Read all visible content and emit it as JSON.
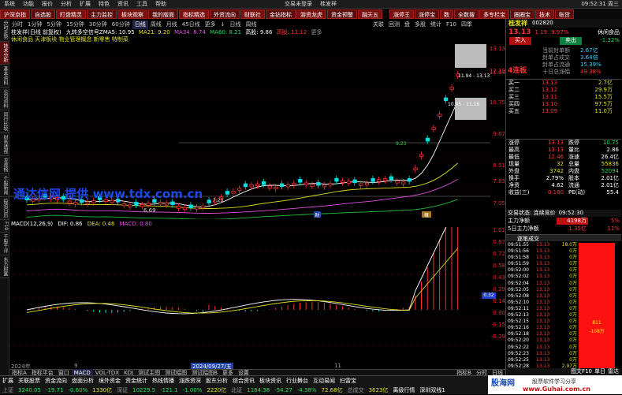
{
  "menu": {
    "items": [
      "系统",
      "功能",
      "报价",
      "分析",
      "扩展",
      "特色",
      "资讯",
      "工具",
      "帮助"
    ],
    "status": "交易未登录",
    "brand": "桂发祥",
    "clock": "09:52:31 周三"
  },
  "topbar": [
    "沪深京指",
    "自选股",
    "盯盘精灵",
    "主力监控",
    "板块观察",
    "我的版面",
    "指标精选",
    "外资流向",
    "财联社",
    "金钻指标",
    "游资龙虎",
    "资金预警",
    "融天五",
    "",
    "涨停王",
    "涨停宝",
    "数",
    "全数搜",
    "多专栏宝",
    "圈圈宝",
    "技术",
    "账贷"
  ],
  "left_strip": [
    "分时走势",
    "技术分析",
    "基本资料",
    "公司资料",
    "同行比较",
    "财务透视",
    "龙虎榜",
    "个股新闻",
    "投资日历",
    "F10",
    "千股千评",
    "东方财富"
  ],
  "period": [
    "分时",
    "1分钟",
    "5分钟",
    "15分钟",
    "30分钟",
    "60分钟",
    "日线",
    "周线",
    "月线",
    "45日线",
    "更多",
    "↓",
    "日线",
    "周线"
  ],
  "period_right": [
    "关联",
    "回测",
    "盘",
    "多股",
    "统计",
    "F10",
    "四季"
  ],
  "chart": {
    "title_line": "桂发祥(日线 前复权)",
    "ma_line": [
      "九转多空信号ZMA5: 10.95",
      "MA21: 9.20",
      "MA34: 8.74",
      "MA60: 8.21",
      "高股: 9.86",
      "高股: 11.12",
      "更多"
    ],
    "concept_line": "休闲食品 天津板块 物业管理概念 新零售 特制菜",
    "watermark": "通达信网 提供 www.tdx.com.cn",
    "price_label_low": "6.69",
    "price_label_mid1": "7.23",
    "price_label_mid2": "9.23",
    "price_label_box": "10.95 - 11.16",
    "price_label_top": "11.94 - 13.13",
    "ticks": [
      "13.13",
      "12.19",
      "11.04",
      "10.75",
      "9.67",
      "8.51",
      "7.83",
      "7.05"
    ],
    "macd_title": "MACD(12,26,9)",
    "macd_vals": [
      "DIF: 0.86",
      "DEA: 0.46",
      "MACD: 0.80"
    ],
    "macd_ticks": [
      "1.01",
      "0.87",
      "0.72",
      "0.58",
      "0.43",
      "0.29",
      "0.14",
      "0.00",
      "-0.15",
      "-0.29"
    ],
    "macd_marker": "0.32",
    "date_left": "2024年",
    "date_mid": "2024/09/27/五",
    "date_9": "9",
    "date_11": "11",
    "date_right": "22"
  },
  "bottom_tabs": [
    "指标A",
    "指标平台",
    "窗口",
    "MACD",
    "VOL-TDX",
    "KDJ",
    "测试主图",
    "测试幅图",
    "测试幅图B",
    "更多",
    "设置",
    "",
    "指标B",
    "分时",
    "日线"
  ],
  "bottom_tabs2": [
    "扩展",
    "关联股票",
    "资金流向",
    "盘面分析",
    "境外资金",
    "资金统计",
    "热线情播",
    "涨跌资深",
    "股东分析",
    "综合资讯",
    "板块资讯",
    "行业舞台",
    "互动易闻",
    "扫雷宝"
  ],
  "quote": {
    "name": "桂发祥",
    "code": "002820",
    "price": "13.13",
    "change": "1.19",
    "pct": "9.97%",
    "index_label": "休闲食品",
    "index_pct": "-1.32%",
    "buy_btn": "买入",
    "sell_btn": "卖出",
    "lianban": "4连板",
    "lb_info": [
      {
        "k": "当前封单额",
        "v": "2.67亿"
      },
      {
        "k": "封单占成交",
        "v": "3.64倍"
      },
      {
        "k": "封单占流通",
        "v": "15.39%"
      },
      {
        "k": "十日总涨幅",
        "v": "49.38%"
      }
    ],
    "asks": [
      {
        "k": "卖五",
        "p": "",
        "v": ""
      },
      {
        "k": "卖四",
        "p": "",
        "v": ""
      },
      {
        "k": "卖三",
        "p": "",
        "v": ""
      },
      {
        "k": "卖二",
        "p": "",
        "v": ""
      },
      {
        "k": "卖一",
        "p": "",
        "v": ""
      }
    ],
    "bids": [
      {
        "k": "买一",
        "p": "13.13",
        "v": "2.7亿"
      },
      {
        "k": "买二",
        "p": "13.12",
        "v": "29.9万"
      },
      {
        "k": "买三",
        "p": "13.11",
        "v": "15.5万"
      },
      {
        "k": "买四",
        "p": "13.10",
        "v": "97.5万"
      },
      {
        "k": "买五",
        "p": "13.09",
        "v": "11.0万"
      }
    ],
    "stats": [
      {
        "a": "涨停",
        "av": "13.13",
        "b": "跌停",
        "bv": "10.75"
      },
      {
        "a": "最高",
        "av": "13.13",
        "b": "量比",
        "bv": "2.86"
      },
      {
        "a": "最低",
        "av": "12.46",
        "b": "涨速",
        "bv": "26.4亿"
      },
      {
        "a": "现量",
        "av": "32",
        "b": "总量",
        "bv": "55836"
      },
      {
        "a": "外盘",
        "av": "3742",
        "b": "内盘",
        "bv": "52094"
      },
      {
        "a": "换手",
        "av": "2.79%",
        "b": "股本",
        "bv": "2.01亿"
      },
      {
        "a": "净资",
        "av": "4.62",
        "b": "流通",
        "bv": "2.01亿"
      },
      {
        "a": "收益(三)",
        "av": "0.180",
        "b": "PE(动)",
        "bv": "55.4"
      }
    ],
    "trade_status": "交易状态: 连续竞价",
    "trade_time": "09:52:30",
    "main_net_label": "主力净额",
    "main_net": "4198万",
    "main_net_pct": "5%",
    "main5_label": "5日主力净额",
    "main5": "1.35亿",
    "main5_pct": "11%",
    "ticks_title": "逐笔成交",
    "tick_rows": [
      {
        "t": "09:51:55",
        "p": "13.13",
        "v": "18.0万"
      },
      {
        "t": "09:51:56",
        "p": "13.13",
        "v": "0万"
      },
      {
        "t": "09:51:58",
        "p": "13.13",
        "v": "0万"
      },
      {
        "t": "09:51:59",
        "p": "13.13",
        "v": "0万"
      },
      {
        "t": "09:52:00",
        "p": "13.13",
        "v": "0万"
      },
      {
        "t": "09:52:02",
        "p": "13.13",
        "v": "0万"
      },
      {
        "t": "09:52:04",
        "p": "13.13",
        "v": "0万"
      },
      {
        "t": "09:52:05",
        "p": "13.13",
        "v": "0万"
      },
      {
        "t": "09:52:08",
        "p": "13.13",
        "v": "0万"
      },
      {
        "t": "09:52:10",
        "p": "13.13",
        "v": "0万"
      },
      {
        "t": "09:52:11",
        "p": "13.13",
        "v": "0万"
      },
      {
        "t": "09:52:13",
        "p": "13.13",
        "v": "0万"
      },
      {
        "t": "09:52:15",
        "p": "13.13",
        "v": "0万"
      },
      {
        "t": "09:52:16",
        "p": "13.13",
        "v": "0万"
      },
      {
        "t": "09:52:18",
        "p": "13.13",
        "v": "0万"
      },
      {
        "t": "09:52:20",
        "p": "13.13",
        "v": "0万"
      },
      {
        "t": "09:52:22",
        "p": "13.13",
        "v": "0万"
      },
      {
        "t": "09:52:23",
        "p": "13.13",
        "v": "0万"
      },
      {
        "t": "09:52:25",
        "p": "13.13",
        "v": "0万"
      },
      {
        "t": "09:52:28",
        "p": "13.13",
        "v": "2.97万"
      }
    ],
    "bar_val": "811",
    "bar_val2": "-108万",
    "bottom_tabs": [
      "图文F10",
      "单日",
      "雷达"
    ]
  },
  "statusbar": {
    "row1": [
      {
        "t": "上证",
        "c": "gray"
      },
      {
        "t": "3240.05",
        "c": "green"
      },
      {
        "t": "-19.71",
        "c": "green"
      },
      {
        "t": "-0.60%",
        "c": "green"
      },
      {
        "t": "1330亿",
        "c": "yellow"
      },
      {
        "t": "深证",
        "c": "gray"
      },
      {
        "t": "10229.5",
        "c": "green"
      },
      {
        "t": "-121.1",
        "c": "green"
      },
      {
        "t": "-1.00%",
        "c": "green"
      },
      {
        "t": "2220亿",
        "c": "yellow"
      },
      {
        "t": "北证",
        "c": "gray"
      },
      {
        "t": "1184.38",
        "c": "green"
      },
      {
        "t": "-54.27",
        "c": "green"
      },
      {
        "t": "-4.38%",
        "c": "green"
      },
      {
        "t": "72.68亿",
        "c": "yellow"
      },
      {
        "t": "总成交",
        "c": "gray"
      },
      {
        "t": "3623亿",
        "c": "yellow"
      },
      {
        "t": "离级行情",
        "c": "white"
      },
      {
        "t": "深圳双线1",
        "c": "white"
      }
    ],
    "logo_main": "股海网",
    "logo_sub": "股票软件学习分享",
    "logo_url": "www.Guhai.com.cn"
  }
}
